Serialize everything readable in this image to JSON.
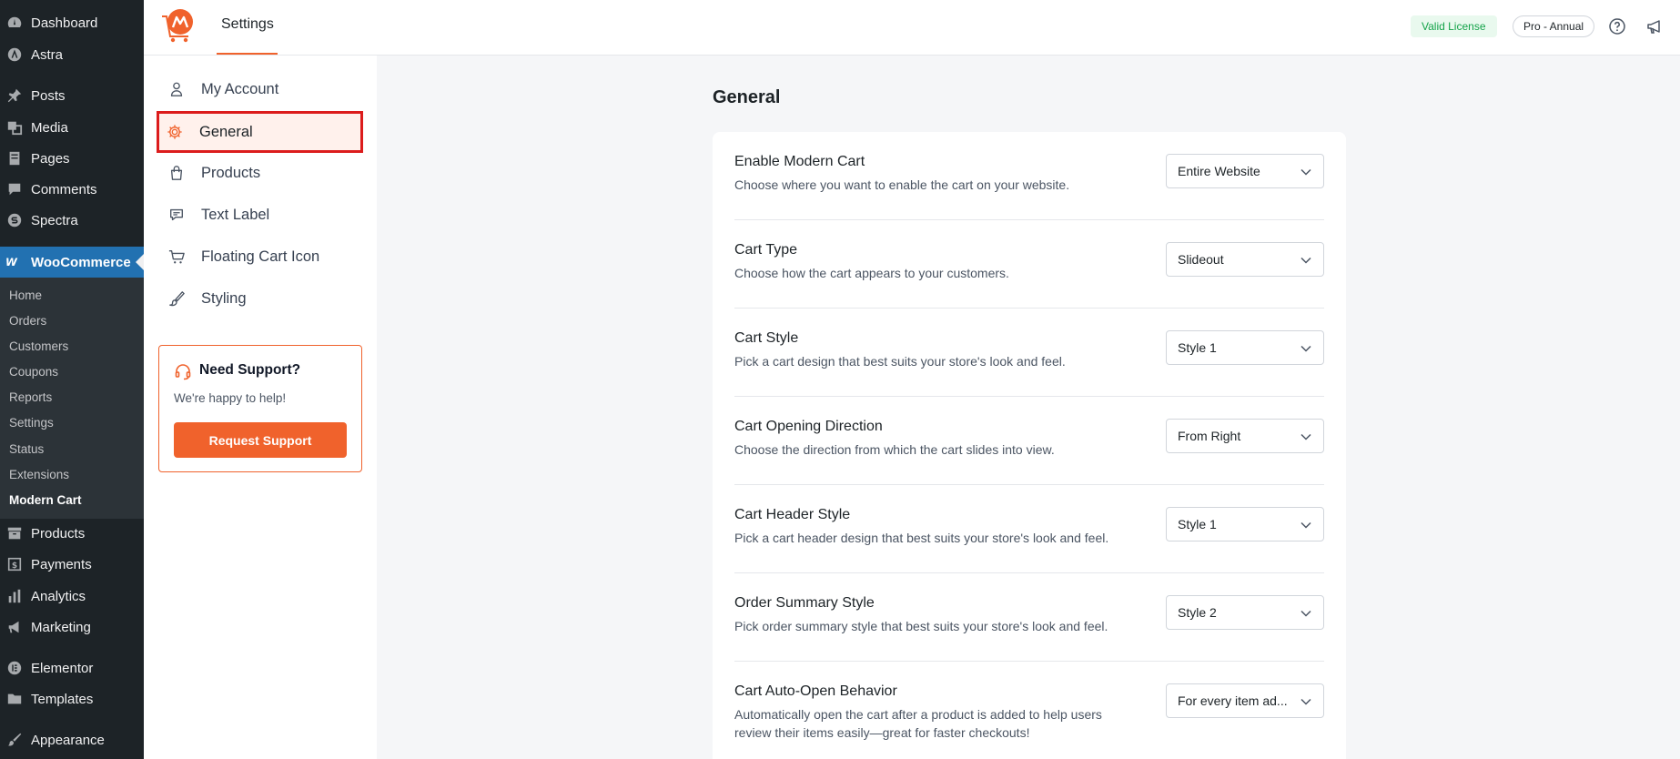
{
  "wp_menu": {
    "items": [
      {
        "label": "Dashboard",
        "icon": "dashboard-icon"
      },
      {
        "label": "Astra",
        "icon": "astra-icon"
      },
      {
        "label": "Posts",
        "icon": "pin-icon"
      },
      {
        "label": "Media",
        "icon": "media-icon"
      },
      {
        "label": "Pages",
        "icon": "pages-icon"
      },
      {
        "label": "Comments",
        "icon": "comment-icon"
      },
      {
        "label": "Spectra",
        "icon": "spectra-icon"
      },
      {
        "label": "WooCommerce",
        "icon": "woocommerce-icon"
      },
      {
        "label": "Products",
        "icon": "archive-icon"
      },
      {
        "label": "Payments",
        "icon": "payments-icon"
      },
      {
        "label": "Analytics",
        "icon": "analytics-icon"
      },
      {
        "label": "Marketing",
        "icon": "megaphone-icon"
      },
      {
        "label": "Elementor",
        "icon": "elementor-icon"
      },
      {
        "label": "Templates",
        "icon": "folder-icon"
      },
      {
        "label": "Appearance",
        "icon": "brush-icon"
      }
    ],
    "submenu": [
      "Home",
      "Orders",
      "Customers",
      "Coupons",
      "Reports",
      "Settings",
      "Status",
      "Extensions",
      "Modern Cart"
    ]
  },
  "topbar": {
    "title": "Settings",
    "license": "Valid License",
    "plan": "Pro - Annual"
  },
  "settings_nav": {
    "items": [
      {
        "label": "My Account",
        "icon": "user-icon"
      },
      {
        "label": "General",
        "icon": "gear-icon"
      },
      {
        "label": "Products",
        "icon": "bag-icon"
      },
      {
        "label": "Text Label",
        "icon": "chat-icon"
      },
      {
        "label": "Floating Cart Icon",
        "icon": "cart-icon"
      },
      {
        "label": "Styling",
        "icon": "brush-icon"
      }
    ],
    "support": {
      "title": "Need Support?",
      "subtitle": "We're happy to help!",
      "button": "Request Support"
    }
  },
  "main": {
    "title": "General",
    "rows": [
      {
        "title": "Enable Modern Cart",
        "desc": "Choose where you want to enable the cart on your website.",
        "value": "Entire Website"
      },
      {
        "title": "Cart Type",
        "desc": "Choose how the cart appears to your customers.",
        "value": "Slideout"
      },
      {
        "title": "Cart Style",
        "desc": "Pick a cart design that best suits your store's look and feel.",
        "value": "Style 1"
      },
      {
        "title": "Cart Opening Direction",
        "desc": "Choose the direction from which the cart slides into view.",
        "value": "From Right"
      },
      {
        "title": "Cart Header Style",
        "desc": "Pick a cart header design that best suits your store's look and feel.",
        "value": "Style 1"
      },
      {
        "title": "Order Summary Style",
        "desc": "Pick order summary style that best suits your store's look and feel.",
        "value": "Style 2"
      },
      {
        "title": "Cart Auto-Open Behavior",
        "desc": "Automatically open the cart after a product is added to help users review their items easily—great for faster checkouts!",
        "value": "For every item ad..."
      }
    ]
  },
  "colors": {
    "accent": "#f0622c",
    "wp_sidebar": "#1d2327",
    "wp_active": "#2271b1",
    "highlight_border": "#dc1c1c"
  }
}
